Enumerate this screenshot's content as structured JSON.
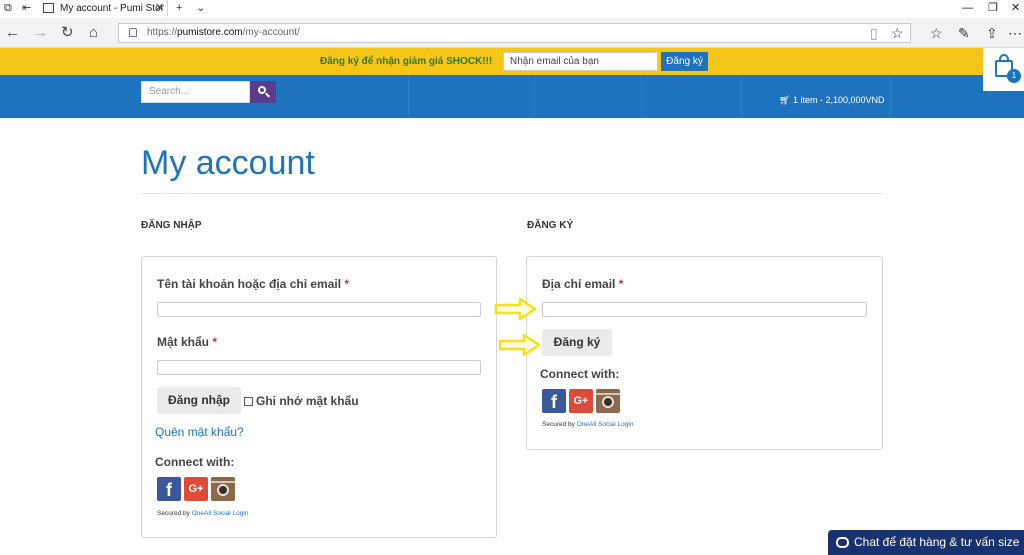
{
  "browser": {
    "tab_title": "My account - Pumi Stor",
    "url_scheme": "https://",
    "url_host": "pumistore.com",
    "url_path": "/my-account/"
  },
  "promo": {
    "text": "Đăng ký để nhận giảm giá SHOCK!!!",
    "email_placeholder": "Nhận email của bạn",
    "button": "Đăng ký"
  },
  "header": {
    "search_placeholder": "Search...",
    "cart_summary": "1 item - 2,100,000VND",
    "cart_count": "1"
  },
  "page": {
    "title": "My account"
  },
  "login": {
    "heading": "ĐĂNG NHẬP",
    "username_label": "Tên tài khoản hoặc địa chỉ email",
    "password_label": "Mật khẩu",
    "required_mark": "*",
    "login_button": "Đăng nhập",
    "remember_label": "Ghi nhớ mật khẩu",
    "lost_password": "Quên mật khẩu?",
    "connect_with": "Connect with:",
    "secured_by": "Secured by",
    "secured_link": "OneAll Social Login"
  },
  "register": {
    "heading": "ĐĂNG KÝ",
    "email_label": "Địa chỉ email",
    "required_mark": "*",
    "register_button": "Đăng ký",
    "connect_with": "Connect with:",
    "secured_by": "Secured by",
    "secured_link": "OneAll Social Login"
  },
  "chat": {
    "label": "Chat để đặt hàng & tư vấn size"
  },
  "colors": {
    "promo_bg": "#f5c518",
    "header_bg": "#1e73be",
    "title": "#1e73be",
    "arrow": "#f4e11a",
    "chat_bg": "#17326e"
  }
}
